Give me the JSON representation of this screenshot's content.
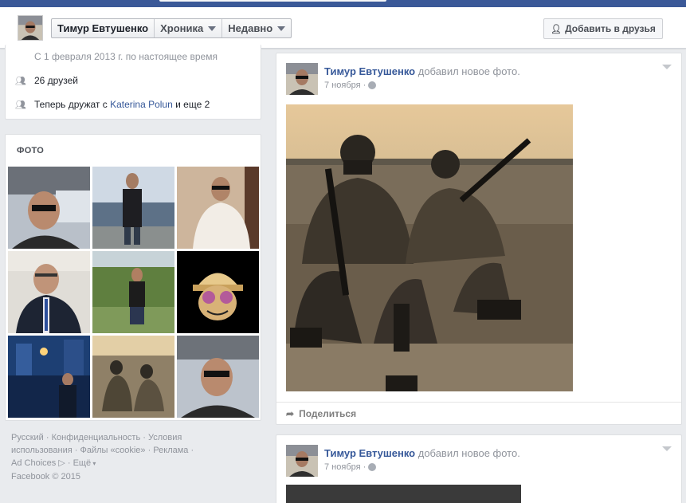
{
  "header": {
    "profile_name": "Тимур Евтушенко",
    "timeline_label": "Хроника",
    "recent_label": "Недавно",
    "add_friend_label": "Добавить в друзья",
    "add_friend_icon": "person-add-icon"
  },
  "intro": {
    "since_text": "С 1 февраля 2013 г. по настоящее время",
    "friends_count": "26 друзей",
    "friends_with_prefix": "Теперь дружат с",
    "friends_with_name": "Katerina Polun",
    "friends_with_suffix": "и еще 2"
  },
  "photos": {
    "heading": "ФОТО",
    "items": [
      {
        "name": "photo-selfie-car"
      },
      {
        "name": "photo-boat"
      },
      {
        "name": "photo-white-sweater"
      },
      {
        "name": "photo-suit"
      },
      {
        "name": "photo-park"
      },
      {
        "name": "photo-cartoon"
      },
      {
        "name": "photo-station"
      },
      {
        "name": "photo-soldiers"
      },
      {
        "name": "photo-selfie-car-2"
      }
    ]
  },
  "footer": {
    "line1": [
      "Русский",
      "Конфиденциальность",
      "Условия"
    ],
    "line2": [
      "использования",
      "Файлы «cookie»",
      "Реклама"
    ],
    "ad_choices": "Ad Choices",
    "more": "Ещё",
    "copyright": "Facebook © 2015"
  },
  "posts": [
    {
      "author": "Тимур Евтушенко",
      "action": "добавил новое фото.",
      "date": "7 ноября",
      "share_label": "Поделиться"
    },
    {
      "author": "Тимур Евтушенко",
      "action": "добавил новое фото.",
      "date": "7 ноября"
    }
  ],
  "colors": {
    "brand": "#3b5998",
    "link": "#365899",
    "muted": "#90949c"
  }
}
